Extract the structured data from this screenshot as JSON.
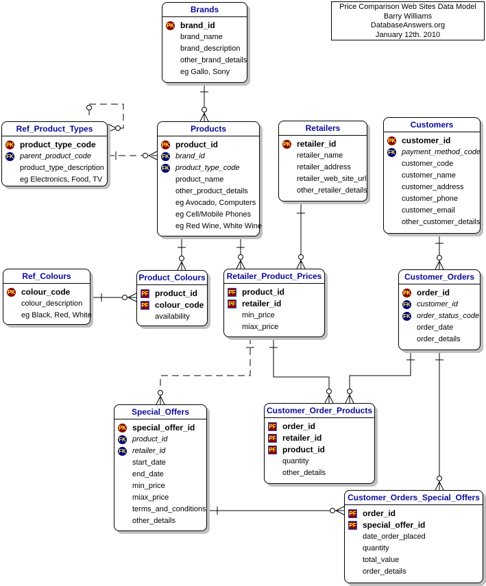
{
  "note": {
    "lines": [
      "Price Comparison Web Sites Data Model",
      "Barry Williams",
      "DatabaseAnswers.org",
      "January 12th. 2010"
    ]
  },
  "entities": {
    "brands": {
      "title": "Brands",
      "attrs": [
        {
          "badge": "PK",
          "name": "brand_id"
        },
        {
          "badge": "",
          "name": "brand_name"
        },
        {
          "badge": "",
          "name": "brand_description"
        },
        {
          "badge": "",
          "name": "other_brand_details"
        },
        {
          "badge": "",
          "name": "eg Gallo, Sony"
        }
      ]
    },
    "ref_product_types": {
      "title": "Ref_Product_Types",
      "attrs": [
        {
          "badge": "PK",
          "name": "product_type_code"
        },
        {
          "badge": "FK",
          "name": "parent_product_code"
        },
        {
          "badge": "",
          "name": "product_type_description"
        },
        {
          "badge": "",
          "name": "eg Electronics, Food, TV"
        }
      ]
    },
    "products": {
      "title": "Products",
      "attrs": [
        {
          "badge": "PK",
          "name": "product_id"
        },
        {
          "badge": "FK",
          "name": "brand_id"
        },
        {
          "badge": "FK",
          "name": "product_type_code"
        },
        {
          "badge": "",
          "name": "product_name"
        },
        {
          "badge": "",
          "name": "other_product_details"
        },
        {
          "badge": "",
          "name": "eg Avocado, Computers"
        },
        {
          "badge": "",
          "name": "eg Cell/Mobile Phones"
        },
        {
          "badge": "",
          "name": "eg Red Wine, White Wine"
        }
      ]
    },
    "retailers": {
      "title": "Retailers",
      "attrs": [
        {
          "badge": "PK",
          "name": "retailer_id"
        },
        {
          "badge": "",
          "name": "retailer_name"
        },
        {
          "badge": "",
          "name": "retailer_address"
        },
        {
          "badge": "",
          "name": "retailer_web_site_url"
        },
        {
          "badge": "",
          "name": "other_retailer_details"
        }
      ]
    },
    "customers": {
      "title": "Customers",
      "attrs": [
        {
          "badge": "PK",
          "name": "customer_id"
        },
        {
          "badge": "FK",
          "name": "payment_method_code"
        },
        {
          "badge": "",
          "name": "customer_code"
        },
        {
          "badge": "",
          "name": "customer_name"
        },
        {
          "badge": "",
          "name": "customer_address"
        },
        {
          "badge": "",
          "name": "customer_phone"
        },
        {
          "badge": "",
          "name": "customer_email"
        },
        {
          "badge": "",
          "name": "other_customer_details"
        }
      ]
    },
    "ref_colours": {
      "title": "Ref_Colours",
      "attrs": [
        {
          "badge": "PK",
          "name": "colour_code"
        },
        {
          "badge": "",
          "name": "colour_description"
        },
        {
          "badge": "",
          "name": "eg Black, Red, White"
        }
      ]
    },
    "product_colours": {
      "title": "Product_Colours",
      "attrs": [
        {
          "badge": "PF",
          "name": "product_id"
        },
        {
          "badge": "PF",
          "name": "colour_code"
        },
        {
          "badge": "",
          "name": "availability"
        }
      ]
    },
    "retailer_product_prices": {
      "title": "Retailer_Product_Prices",
      "attrs": [
        {
          "badge": "PF",
          "name": "product_id"
        },
        {
          "badge": "PF",
          "name": "retailer_id"
        },
        {
          "badge": "",
          "name": "min_price"
        },
        {
          "badge": "",
          "name": "miax_price"
        }
      ]
    },
    "customer_orders": {
      "title": "Customer_Orders",
      "attrs": [
        {
          "badge": "PK",
          "name": "order_id"
        },
        {
          "badge": "FK",
          "name": "customer_id"
        },
        {
          "badge": "FK",
          "name": "order_status_code"
        },
        {
          "badge": "",
          "name": "order_date"
        },
        {
          "badge": "",
          "name": "order_details"
        }
      ]
    },
    "special_offers": {
      "title": "Special_Offers",
      "attrs": [
        {
          "badge": "PK",
          "name": "special_offer_id"
        },
        {
          "badge": "FK",
          "name": "product_id"
        },
        {
          "badge": "FK",
          "name": "retailer_id"
        },
        {
          "badge": "",
          "name": "start_date"
        },
        {
          "badge": "",
          "name": "end_date"
        },
        {
          "badge": "",
          "name": "min_price"
        },
        {
          "badge": "",
          "name": "miax_price"
        },
        {
          "badge": "",
          "name": "terms_and_conditions"
        },
        {
          "badge": "",
          "name": "other_details"
        }
      ]
    },
    "customer_order_products": {
      "title": "Customer_Order_Products",
      "attrs": [
        {
          "badge": "PF",
          "name": "order_id"
        },
        {
          "badge": "PF",
          "name": "retailer_id"
        },
        {
          "badge": "PF",
          "name": "product_id"
        },
        {
          "badge": "",
          "name": "quantity"
        },
        {
          "badge": "",
          "name": "other_details"
        }
      ]
    },
    "customer_orders_special_offers": {
      "title": "Customer_Orders_Special_Offers",
      "attrs": [
        {
          "badge": "PF",
          "name": "order_id"
        },
        {
          "badge": "PF",
          "name": "special_offer_id"
        },
        {
          "badge": "",
          "name": "date_order_placed"
        },
        {
          "badge": "",
          "name": "quantity"
        },
        {
          "badge": "",
          "name": "total_value"
        },
        {
          "badge": "",
          "name": "order_details"
        }
      ]
    }
  },
  "relationships": [
    {
      "from": "brands",
      "to": "products",
      "identifying": true
    },
    {
      "from": "ref_product_types",
      "to": "ref_product_types",
      "identifying": false
    },
    {
      "from": "ref_product_types",
      "to": "products",
      "identifying": false
    },
    {
      "from": "products",
      "to": "product_colours",
      "identifying": true
    },
    {
      "from": "products",
      "to": "retailer_product_prices",
      "identifying": true
    },
    {
      "from": "retailers",
      "to": "retailer_product_prices",
      "identifying": true
    },
    {
      "from": "ref_colours",
      "to": "product_colours",
      "identifying": true
    },
    {
      "from": "customers",
      "to": "customer_orders",
      "identifying": true
    },
    {
      "from": "retailer_product_prices",
      "to": "special_offers",
      "identifying": false
    },
    {
      "from": "retailer_product_prices",
      "to": "customer_order_products",
      "identifying": true
    },
    {
      "from": "customer_orders",
      "to": "customer_order_products",
      "identifying": true
    },
    {
      "from": "customer_orders",
      "to": "customer_orders_special_offers",
      "identifying": true
    },
    {
      "from": "special_offers",
      "to": "customer_orders_special_offers",
      "identifying": true
    }
  ]
}
